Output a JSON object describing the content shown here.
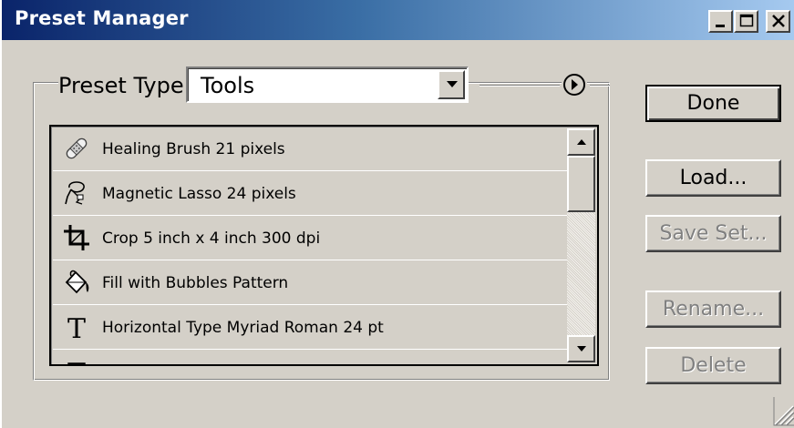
{
  "window": {
    "title": "Preset Manager",
    "controls": [
      "minimize",
      "maximize",
      "close"
    ]
  },
  "preset_type": {
    "label": "Preset Type:",
    "selected": "Tools"
  },
  "list": {
    "items": [
      {
        "icon": "healing-brush-icon",
        "label": "Healing Brush 21 pixels"
      },
      {
        "icon": "magnetic-lasso-icon",
        "label": "Magnetic Lasso 24 pixels"
      },
      {
        "icon": "crop-icon",
        "label": "Crop 5 inch x 4 inch 300 dpi"
      },
      {
        "icon": "paint-bucket-icon",
        "label": "Fill with Bubbles Pattern"
      },
      {
        "icon": "type-icon",
        "label": "Horizontal Type Myriad Roman 24 pt"
      },
      {
        "icon": "vertical-type-icon",
        "label": ""
      }
    ]
  },
  "buttons": {
    "done": "Done",
    "load": "Load...",
    "save_set": "Save Set...",
    "rename": "Rename...",
    "delete": "Delete"
  },
  "colors": {
    "face": "#d4d0c8",
    "title_start": "#0a246a",
    "title_end": "#a6caf0",
    "disabled_text": "#808080"
  }
}
